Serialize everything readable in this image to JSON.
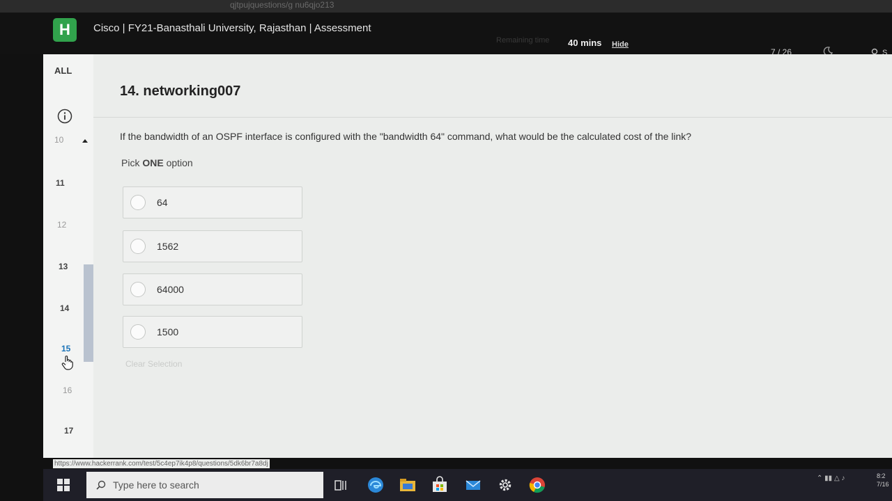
{
  "browser": {
    "url_fragment": "qjtpujquestions/g nu6qjo213"
  },
  "header": {
    "logo_letter": "H",
    "title": "Cisco | FY21-Banasthali University, Rajasthan | Assessment",
    "remaining_label": "Remaining time",
    "timer": "40 mins",
    "hide_label": "Hide",
    "progress": "7 / 26",
    "user_initial": "S"
  },
  "sidebar": {
    "all_label": "ALL",
    "questions": [
      "10",
      "11",
      "12",
      "13",
      "14",
      "15",
      "16",
      "17"
    ],
    "current_question": "15"
  },
  "question": {
    "title": "14. networking007",
    "text": "If the bandwidth of an OSPF interface is configured with the \"bandwidth 64\" command, what would be the calculated cost of the link?",
    "pick_prefix": "Pick ",
    "pick_bold": "ONE",
    "pick_suffix": " option",
    "options": [
      "64",
      "1562",
      "64000",
      "1500"
    ],
    "clear_selection": "Clear Selection"
  },
  "status_bar": {
    "url": "https://www.hackerrank.com/test/5c4ep7ik4p8/questions/5dk6br7a8dj"
  },
  "taskbar": {
    "search_placeholder": "Type here to search",
    "time": "8:2",
    "date": "7/16"
  },
  "colors": {
    "accent_green": "#31a24c",
    "header_bg": "#121212",
    "link_blue": "#1a73b8"
  }
}
